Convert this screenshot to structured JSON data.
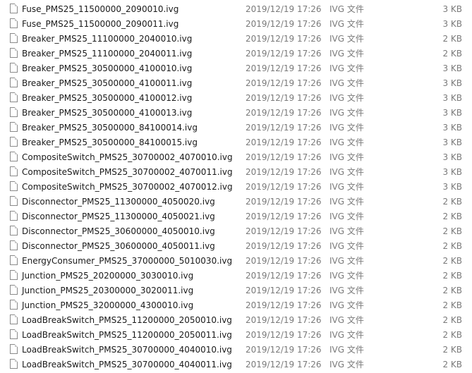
{
  "files": [
    {
      "name": "Fuse_PMS25_11500000_2090010.ivg",
      "date": "2019/12/19 17:26",
      "type": "IVG 文件",
      "size": "3 KB",
      "icon": "file-icon"
    },
    {
      "name": "Fuse_PMS25_11500000_2090011.ivg",
      "date": "2019/12/19 17:26",
      "type": "IVG 文件",
      "size": "3 KB",
      "icon": "file-icon"
    },
    {
      "name": "Breaker_PMS25_11100000_2040010.ivg",
      "date": "2019/12/19 17:26",
      "type": "IVG 文件",
      "size": "2 KB",
      "icon": "file-icon"
    },
    {
      "name": "Breaker_PMS25_11100000_2040011.ivg",
      "date": "2019/12/19 17:26",
      "type": "IVG 文件",
      "size": "2 KB",
      "icon": "file-icon"
    },
    {
      "name": "Breaker_PMS25_30500000_4100010.ivg",
      "date": "2019/12/19 17:26",
      "type": "IVG 文件",
      "size": "3 KB",
      "icon": "file-icon"
    },
    {
      "name": "Breaker_PMS25_30500000_4100011.ivg",
      "date": "2019/12/19 17:26",
      "type": "IVG 文件",
      "size": "3 KB",
      "icon": "file-icon"
    },
    {
      "name": "Breaker_PMS25_30500000_4100012.ivg",
      "date": "2019/12/19 17:26",
      "type": "IVG 文件",
      "size": "3 KB",
      "icon": "file-icon"
    },
    {
      "name": "Breaker_PMS25_30500000_4100013.ivg",
      "date": "2019/12/19 17:26",
      "type": "IVG 文件",
      "size": "3 KB",
      "icon": "file-icon"
    },
    {
      "name": "Breaker_PMS25_30500000_84100014.ivg",
      "date": "2019/12/19 17:26",
      "type": "IVG 文件",
      "size": "3 KB",
      "icon": "file-icon"
    },
    {
      "name": "Breaker_PMS25_30500000_84100015.ivg",
      "date": "2019/12/19 17:26",
      "type": "IVG 文件",
      "size": "3 KB",
      "icon": "file-icon"
    },
    {
      "name": "CompositeSwitch_PMS25_30700002_4070010.ivg",
      "date": "2019/12/19 17:26",
      "type": "IVG 文件",
      "size": "3 KB",
      "icon": "file-icon"
    },
    {
      "name": "CompositeSwitch_PMS25_30700002_4070011.ivg",
      "date": "2019/12/19 17:26",
      "type": "IVG 文件",
      "size": "3 KB",
      "icon": "file-icon"
    },
    {
      "name": "CompositeSwitch_PMS25_30700002_4070012.ivg",
      "date": "2019/12/19 17:26",
      "type": "IVG 文件",
      "size": "3 KB",
      "icon": "file-icon"
    },
    {
      "name": "Disconnector_PMS25_11300000_4050020.ivg",
      "date": "2019/12/19 17:26",
      "type": "IVG 文件",
      "size": "2 KB",
      "icon": "file-icon"
    },
    {
      "name": "Disconnector_PMS25_11300000_4050021.ivg",
      "date": "2019/12/19 17:26",
      "type": "IVG 文件",
      "size": "2 KB",
      "icon": "file-icon"
    },
    {
      "name": "Disconnector_PMS25_30600000_4050010.ivg",
      "date": "2019/12/19 17:26",
      "type": "IVG 文件",
      "size": "2 KB",
      "icon": "file-icon"
    },
    {
      "name": "Disconnector_PMS25_30600000_4050011.ivg",
      "date": "2019/12/19 17:26",
      "type": "IVG 文件",
      "size": "2 KB",
      "icon": "file-icon"
    },
    {
      "name": "EnergyConsumer_PMS25_37000000_5010030.ivg",
      "date": "2019/12/19 17:26",
      "type": "IVG 文件",
      "size": "2 KB",
      "icon": "file-icon"
    },
    {
      "name": "Junction_PMS25_20200000_3030010.ivg",
      "date": "2019/12/19 17:26",
      "type": "IVG 文件",
      "size": "2 KB",
      "icon": "file-icon"
    },
    {
      "name": "Junction_PMS25_20300000_3020011.ivg",
      "date": "2019/12/19 17:26",
      "type": "IVG 文件",
      "size": "2 KB",
      "icon": "file-icon"
    },
    {
      "name": "Junction_PMS25_32000000_4300010.ivg",
      "date": "2019/12/19 17:26",
      "type": "IVG 文件",
      "size": "2 KB",
      "icon": "file-icon"
    },
    {
      "name": "LoadBreakSwitch_PMS25_11200000_2050010.ivg",
      "date": "2019/12/19 17:26",
      "type": "IVG 文件",
      "size": "2 KB",
      "icon": "file-icon"
    },
    {
      "name": "LoadBreakSwitch_PMS25_11200000_2050011.ivg",
      "date": "2019/12/19 17:26",
      "type": "IVG 文件",
      "size": "2 KB",
      "icon": "file-icon"
    },
    {
      "name": "LoadBreakSwitch_PMS25_30700000_4040010.ivg",
      "date": "2019/12/19 17:26",
      "type": "IVG 文件",
      "size": "2 KB",
      "icon": "file-icon"
    },
    {
      "name": "LoadBreakSwitch_PMS25_30700000_4040011.ivg",
      "date": "2019/12/19 17:26",
      "type": "IVG 文件",
      "size": "2 KB",
      "icon": "file-icon"
    }
  ]
}
